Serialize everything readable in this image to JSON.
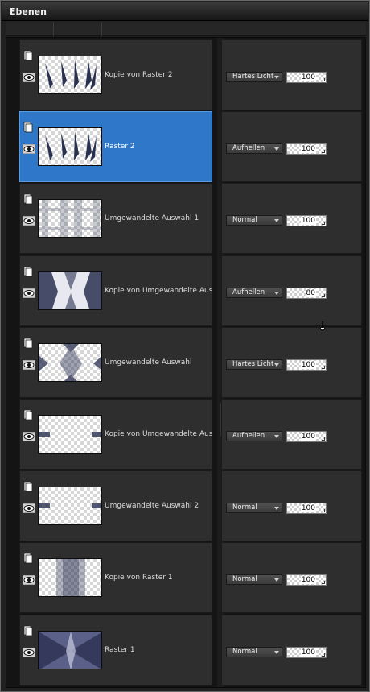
{
  "panel": {
    "title": "Ebenen"
  },
  "layers": [
    {
      "name": "Kopie von Raster 2",
      "blend_mode": "Hartes Licht",
      "opacity": "100",
      "selected": false,
      "thumb": "dark-spikes-icon"
    },
    {
      "name": "Raster 2",
      "blend_mode": "Aufhellen",
      "opacity": "100",
      "selected": true,
      "thumb": "dark-spikes-icon"
    },
    {
      "name": "Umgewandelte Auswahl 1",
      "blend_mode": "Normal",
      "opacity": "100",
      "selected": false,
      "thumb": "faint-columns-pattern"
    },
    {
      "name": "Kopie von Umgewandelte Ausw",
      "blend_mode": "Aufhellen",
      "opacity": "80",
      "selected": false,
      "thumb": "dark-bowtie-pattern"
    },
    {
      "name": "Umgewandelte Auswahl",
      "blend_mode": "Hartes Licht",
      "opacity": "100",
      "selected": false,
      "thumb": "diamond-pattern"
    },
    {
      "name": "Kopie von Umgewandelte Ausw",
      "blend_mode": "Aufhellen",
      "opacity": "100",
      "selected": false,
      "thumb": "edge-bars-pattern"
    },
    {
      "name": "Umgewandelte Auswahl 2",
      "blend_mode": "Normal",
      "opacity": "100",
      "selected": false,
      "thumb": "edge-bars-pattern"
    },
    {
      "name": "Kopie von Raster 1",
      "blend_mode": "Normal",
      "opacity": "100",
      "selected": false,
      "thumb": "blurred-column-pattern"
    },
    {
      "name": "Raster 1",
      "blend_mode": "Normal",
      "opacity": "100",
      "selected": false,
      "thumb": "dark-kaleidoscope-pattern"
    }
  ],
  "colors": {
    "selection": "#2f77c9",
    "row_bg": "#2e2e2e",
    "panel_bg": "#202020",
    "thumb_ink": "#2a3050"
  }
}
